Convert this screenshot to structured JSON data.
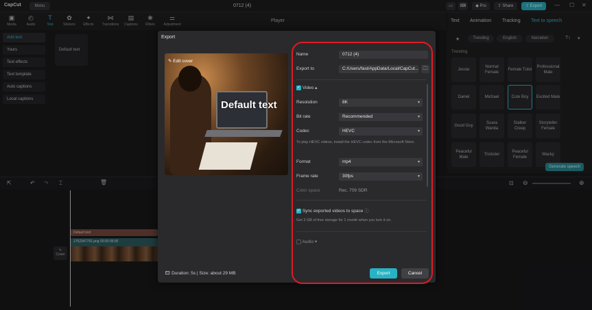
{
  "app": {
    "logo": "CapCut",
    "menu_label": "Menu",
    "project_title": "0712 (4)"
  },
  "titlebar": {
    "pro_label": "Pro",
    "share_label": "Share",
    "export_label": "Export"
  },
  "toolbar": {
    "items": [
      {
        "label": "Media",
        "icon": "media-icon"
      },
      {
        "label": "Audio",
        "icon": "audio-icon"
      },
      {
        "label": "Text",
        "icon": "text-icon"
      },
      {
        "label": "Stickers",
        "icon": "stickers-icon"
      },
      {
        "label": "Effects",
        "icon": "effects-icon"
      },
      {
        "label": "Transitions",
        "icon": "transitions-icon"
      },
      {
        "label": "Captions",
        "icon": "captions-icon"
      },
      {
        "label": "Filters",
        "icon": "filters-icon"
      },
      {
        "label": "Adjustment",
        "icon": "adjustment-icon"
      }
    ]
  },
  "leftnav": {
    "items": [
      "Add text",
      "Yours",
      "Text effects",
      "Text template",
      "Auto captions",
      "Local captions"
    ]
  },
  "text_panel": {
    "default_card": "Default text"
  },
  "player": {
    "title": "Player"
  },
  "rightpanel": {
    "tabs": [
      "Text",
      "Animation",
      "Tracking",
      "Text to speech"
    ],
    "chips": [
      "Trending",
      "English",
      "Narration"
    ],
    "section": "Trending",
    "voices": [
      [
        "Jessie",
        "Normal Female",
        "Female Tutor",
        "Professional Male"
      ],
      [
        "Daniel",
        "Michael",
        "Cute Boy",
        "Excited Male"
      ],
      [
        "Good Guy",
        "Suara Wanita",
        "Stalker Creep",
        "Storyteller Female"
      ],
      [
        "Peaceful Male",
        "Trickster",
        "Peaceful Female",
        "Wacky"
      ]
    ],
    "generate_label": "Generate speech"
  },
  "timeline": {
    "text_clip": "Default text",
    "video_clip": "1752347791.png  00:00:05:00",
    "cover_label": "Cover"
  },
  "dialog": {
    "title": "Export",
    "edit_cover": "Edit cover",
    "preview_text": "Default text",
    "duration": "Duration: 5s | Size: about 29 MB",
    "name_label": "Name",
    "name_value": "0712 (4)",
    "export_to_label": "Export to",
    "export_to_value": "C:/Users/fast/AppData/Local/CapCut...",
    "video_section": "Video",
    "resolution_label": "Resolution",
    "resolution_value": "8K",
    "bitrate_label": "Bit rate",
    "bitrate_value": "Recommended",
    "codec_label": "Codec",
    "codec_value": "HEVC",
    "codec_note": "To play HEVC videos, install the HEVC codec from the Microsoft Store.",
    "format_label": "Format",
    "format_value": "mp4",
    "framerate_label": "Frame rate",
    "framerate_value": "30fps",
    "colorspace_label": "Color space",
    "colorspace_value": "Rec. 709 SDR",
    "sync_label": "Sync exported videos to space",
    "sync_note": "Get 3 GB of free storage for 1 month when you turn it on.",
    "audio_section": "Audio",
    "export_button": "Export",
    "cancel_button": "Cancel"
  },
  "colors": {
    "accent": "#27b3c4",
    "highlight": "#e01b24"
  }
}
